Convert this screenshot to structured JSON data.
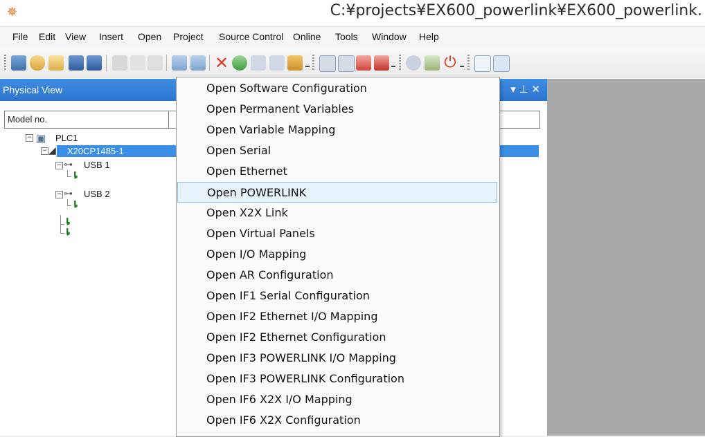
{
  "window": {
    "title": "C:¥projects¥EX600_powerlink¥EX600_powerlink.",
    "app_icon": "automation-studio-icon"
  },
  "menubar": {
    "items": [
      "File",
      "Edit",
      "View",
      "Insert",
      "Open",
      "Project",
      "Source Control",
      "Online",
      "Tools",
      "Window",
      "Help"
    ]
  },
  "toolbar": {
    "buttons": [
      "new-project-icon",
      "open-project-icon",
      "open-folder-icon",
      "save-icon",
      "save-all-icon",
      "cut-icon",
      "copy-icon",
      "paste-icon",
      "undo-icon",
      "redo-icon",
      "delete-icon",
      "refresh-icon",
      "doc-a-icon",
      "doc-b-icon",
      "properties-icon",
      "build-icon",
      "rebuild-icon",
      "transfer-icon",
      "stop-icon",
      "monitor-icon",
      "diagnostic-icon",
      "power-icon",
      "window-icon",
      "window-b-icon"
    ]
  },
  "panel": {
    "title": "Physical View",
    "controls": "▾ ⊥ ✕",
    "column_header": "Model no.",
    "tree": {
      "root": "PLC1",
      "cpu": "X20CP1485-1",
      "usb1": "USB 1",
      "usb2": "USB 2"
    }
  },
  "dropdown": {
    "highlighted": "Open POWERLINK",
    "items": [
      "Open Software Configuration",
      "Open Permanent Variables",
      "Open Variable Mapping",
      "Open Serial",
      "Open Ethernet",
      "Open POWERLINK",
      "Open X2X Link",
      "Open Virtual Panels",
      "Open I/O Mapping",
      "Open AR Configuration",
      "Open IF1 Serial Configuration",
      "Open IF2 Ethernet I/O Mapping",
      "Open IF2 Ethernet Configuration",
      "Open IF3 POWERLINK I/O Mapping",
      "Open IF3 POWERLINK Configuration",
      "Open IF6 X2X I/O Mapping",
      "Open IF6 X2X Configuration"
    ]
  },
  "colors": {
    "panel_header": "#2d74cf",
    "selection": "#3a8ee6",
    "menu_hot": "#e8f2fb"
  }
}
